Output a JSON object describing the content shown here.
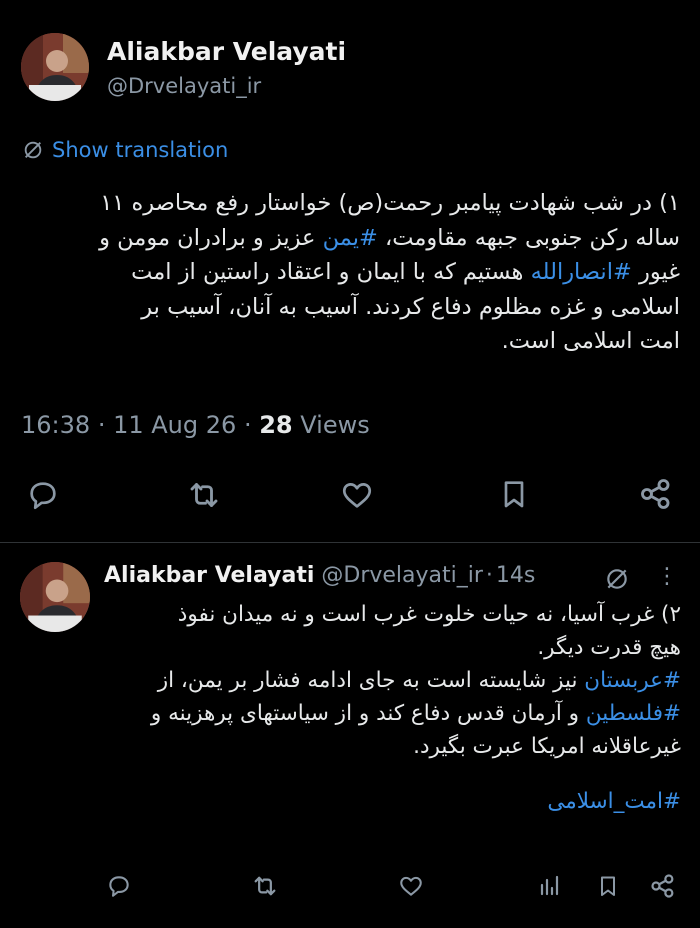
{
  "tweet1": {
    "author_name": "Aliakbar Velayati",
    "author_handle": "@Drvelayati_ir",
    "translate_label": "Show translation",
    "lines": [
      [
        {
          "t": "۱) در شب شهادت پیامبر رحمت(ص) خواستار رفع محاصره ۱۱"
        }
      ],
      [
        {
          "t": "ساله رکن جنوبی جبهه مقاومت، "
        },
        {
          "t": "#یمن",
          "h": 1
        },
        {
          "t": " عزیز و برادران مومن و"
        }
      ],
      [
        {
          "t": "غیور "
        },
        {
          "t": "#انصارالله",
          "h": 1
        },
        {
          "t": " هستیم که با ایمان و اعتقاد راستین از امت"
        }
      ],
      [
        {
          "t": "اسلامی و غزه مظلوم دفاع کردند. آسیب به آنان، آسیب بر"
        }
      ],
      [
        {
          "t": "امت اسلامی است."
        }
      ]
    ],
    "time": "16:38",
    "date": "11 Aug 26",
    "views_count": "28",
    "views_label": "Views",
    "dot": "·"
  },
  "tweet2": {
    "author_name": "Aliakbar Velayati",
    "author_handle": "@Drvelayati_ir",
    "dot": "·",
    "age": "14s",
    "more": "⋮",
    "lines": [
      [
        {
          "t": "۲) غرب آسیا، نه حیات خلوت غرب است و نه میدان نفوذ"
        }
      ],
      [
        {
          "t": "هیچ قدرت دیگر."
        }
      ],
      [
        {
          "t": "#عربستان",
          "h": 1
        },
        {
          "t": " نیز شایسته است به جای ادامه فشار بر یمن، از"
        }
      ],
      [
        {
          "t": "#فلسطین",
          "h": 1
        },
        {
          "t": " و آرمان قدس دفاع کند و از سیاستهای پرهزینه و"
        }
      ],
      [
        {
          "t": "غیرعاقلانه امریکا عبرت بگیرد."
        }
      ],
      [
        {
          "t": ""
        }
      ],
      [
        {
          "t": "#امت_اسلامی",
          "h": 1
        }
      ]
    ]
  },
  "colors": {
    "background": "#000000",
    "link": "#3b8fe6",
    "muted": "#8b98a5",
    "text": "#e7e9ea"
  },
  "icons": [
    "reply-icon",
    "retweet-icon",
    "like-icon",
    "bookmark-icon",
    "share-icon",
    "views-chart-icon",
    "translate-globe-icon",
    "grok-icon",
    "more-icon"
  ]
}
